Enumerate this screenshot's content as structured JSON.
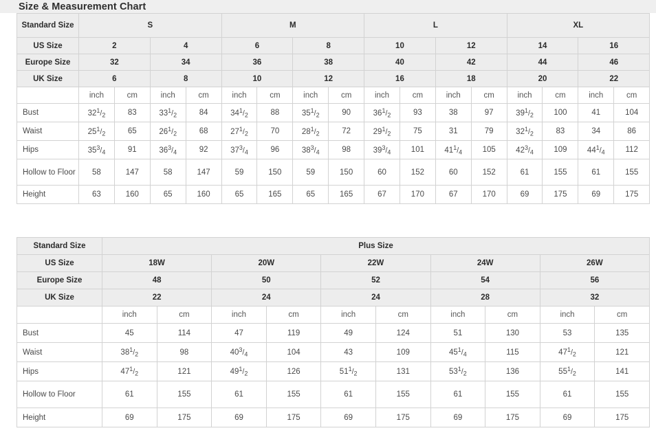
{
  "page": {
    "title": "Size & Measurement Chart",
    "accent_bg": "#efefef",
    "header_cell_bg": "#ededed",
    "border_color": "#d2d2d2"
  },
  "standard_chart": {
    "corner_label": "Standard Size",
    "groups": [
      {
        "label": "S",
        "span": 2
      },
      {
        "label": "M",
        "span": 2
      },
      {
        "label": "L",
        "span": 2
      },
      {
        "label": "XL",
        "span": 2
      }
    ],
    "size_rows": [
      {
        "label": "US Size",
        "values": [
          "2",
          "4",
          "6",
          "8",
          "10",
          "12",
          "14",
          "16"
        ]
      },
      {
        "label": "Europe Size",
        "values": [
          "32",
          "34",
          "36",
          "38",
          "40",
          "42",
          "44",
          "46"
        ]
      },
      {
        "label": "UK Size",
        "values": [
          "6",
          "8",
          "10",
          "12",
          "16",
          "18",
          "20",
          "22"
        ]
      }
    ],
    "unit_row": {
      "label": "",
      "units": [
        "inch",
        "cm",
        "inch",
        "cm",
        "inch",
        "cm",
        "inch",
        "cm",
        "inch",
        "cm",
        "inch",
        "cm",
        "inch",
        "cm",
        "inch",
        "cm"
      ]
    },
    "measurements": [
      {
        "label": "Bust",
        "cells": [
          {
            "whole": "32",
            "num": "1",
            "den": "2"
          },
          {
            "whole": "83"
          },
          {
            "whole": "33",
            "num": "1",
            "den": "2"
          },
          {
            "whole": "84"
          },
          {
            "whole": "34",
            "num": "1",
            "den": "2"
          },
          {
            "whole": "88"
          },
          {
            "whole": "35",
            "num": "1",
            "den": "2"
          },
          {
            "whole": "90"
          },
          {
            "whole": "36",
            "num": "1",
            "den": "2"
          },
          {
            "whole": "93"
          },
          {
            "whole": "38"
          },
          {
            "whole": "97"
          },
          {
            "whole": "39",
            "num": "1",
            "den": "2"
          },
          {
            "whole": "100"
          },
          {
            "whole": "41"
          },
          {
            "whole": "104"
          }
        ]
      },
      {
        "label": "Waist",
        "cells": [
          {
            "whole": "25",
            "num": "1",
            "den": "2"
          },
          {
            "whole": "65"
          },
          {
            "whole": "26",
            "num": "1",
            "den": "2"
          },
          {
            "whole": "68"
          },
          {
            "whole": "27",
            "num": "1",
            "den": "2"
          },
          {
            "whole": "70"
          },
          {
            "whole": "28",
            "num": "1",
            "den": "2"
          },
          {
            "whole": "72"
          },
          {
            "whole": "29",
            "num": "1",
            "den": "2"
          },
          {
            "whole": "75"
          },
          {
            "whole": "31"
          },
          {
            "whole": "79"
          },
          {
            "whole": "32",
            "num": "1",
            "den": "2"
          },
          {
            "whole": "83"
          },
          {
            "whole": "34"
          },
          {
            "whole": "86"
          }
        ]
      },
      {
        "label": "Hips",
        "cells": [
          {
            "whole": "35",
            "num": "3",
            "den": "4"
          },
          {
            "whole": "91"
          },
          {
            "whole": "36",
            "num": "3",
            "den": "4"
          },
          {
            "whole": "92"
          },
          {
            "whole": "37",
            "num": "3",
            "den": "4"
          },
          {
            "whole": "96"
          },
          {
            "whole": "38",
            "num": "3",
            "den": "4"
          },
          {
            "whole": "98"
          },
          {
            "whole": "39",
            "num": "3",
            "den": "4"
          },
          {
            "whole": "101"
          },
          {
            "whole": "41",
            "num": "1",
            "den": "4"
          },
          {
            "whole": "105"
          },
          {
            "whole": "42",
            "num": "3",
            "den": "4"
          },
          {
            "whole": "109"
          },
          {
            "whole": "44",
            "num": "1",
            "den": "4"
          },
          {
            "whole": "112"
          }
        ]
      },
      {
        "label": "Hollow to Floor",
        "tall": true,
        "cells": [
          {
            "whole": "58"
          },
          {
            "whole": "147"
          },
          {
            "whole": "58"
          },
          {
            "whole": "147"
          },
          {
            "whole": "59"
          },
          {
            "whole": "150"
          },
          {
            "whole": "59"
          },
          {
            "whole": "150"
          },
          {
            "whole": "60"
          },
          {
            "whole": "152"
          },
          {
            "whole": "60"
          },
          {
            "whole": "152"
          },
          {
            "whole": "61"
          },
          {
            "whole": "155"
          },
          {
            "whole": "61"
          },
          {
            "whole": "155"
          }
        ]
      },
      {
        "label": "Height",
        "cells": [
          {
            "whole": "63"
          },
          {
            "whole": "160"
          },
          {
            "whole": "65"
          },
          {
            "whole": "160"
          },
          {
            "whole": "65"
          },
          {
            "whole": "165"
          },
          {
            "whole": "65"
          },
          {
            "whole": "165"
          },
          {
            "whole": "67"
          },
          {
            "whole": "170"
          },
          {
            "whole": "67"
          },
          {
            "whole": "170"
          },
          {
            "whole": "69"
          },
          {
            "whole": "175"
          },
          {
            "whole": "69"
          },
          {
            "whole": "175"
          }
        ]
      }
    ]
  },
  "plus_chart": {
    "corner_label": "Standard Size",
    "group_label": "Plus Size",
    "size_rows": [
      {
        "label": "US Size",
        "values": [
          "18W",
          "20W",
          "22W",
          "24W",
          "26W"
        ]
      },
      {
        "label": "Europe Size",
        "values": [
          "48",
          "50",
          "52",
          "54",
          "56"
        ]
      },
      {
        "label": "UK Size",
        "values": [
          "22",
          "24",
          "24",
          "28",
          "32"
        ]
      }
    ],
    "unit_row": {
      "label": "",
      "units": [
        "inch",
        "cm",
        "inch",
        "cm",
        "inch",
        "cm",
        "inch",
        "cm",
        "inch",
        "cm"
      ]
    },
    "measurements": [
      {
        "label": "Bust",
        "cells": [
          {
            "whole": "45"
          },
          {
            "whole": "114"
          },
          {
            "whole": "47"
          },
          {
            "whole": "119"
          },
          {
            "whole": "49"
          },
          {
            "whole": "124"
          },
          {
            "whole": "51"
          },
          {
            "whole": "130"
          },
          {
            "whole": "53"
          },
          {
            "whole": "135"
          }
        ]
      },
      {
        "label": "Waist",
        "cells": [
          {
            "whole": "38",
            "num": "1",
            "den": "2"
          },
          {
            "whole": "98"
          },
          {
            "whole": "40",
            "num": "3",
            "den": "4"
          },
          {
            "whole": "104"
          },
          {
            "whole": "43"
          },
          {
            "whole": "109"
          },
          {
            "whole": "45",
            "num": "1",
            "den": "4"
          },
          {
            "whole": "115"
          },
          {
            "whole": "47",
            "num": "1",
            "den": "2"
          },
          {
            "whole": "121"
          }
        ]
      },
      {
        "label": "Hips",
        "cells": [
          {
            "whole": "47",
            "num": "1",
            "den": "2"
          },
          {
            "whole": "121"
          },
          {
            "whole": "49",
            "num": "1",
            "den": "2"
          },
          {
            "whole": "126"
          },
          {
            "whole": "51",
            "num": "1",
            "den": "2"
          },
          {
            "whole": "131"
          },
          {
            "whole": "53",
            "num": "1",
            "den": "2"
          },
          {
            "whole": "136"
          },
          {
            "whole": "55",
            "num": "1",
            "den": "2"
          },
          {
            "whole": "141"
          }
        ]
      },
      {
        "label": "Hollow to Floor",
        "tall": true,
        "cells": [
          {
            "whole": "61"
          },
          {
            "whole": "155"
          },
          {
            "whole": "61"
          },
          {
            "whole": "155"
          },
          {
            "whole": "61"
          },
          {
            "whole": "155"
          },
          {
            "whole": "61"
          },
          {
            "whole": "155"
          },
          {
            "whole": "61"
          },
          {
            "whole": "155"
          }
        ]
      },
      {
        "label": "Height",
        "cells": [
          {
            "whole": "69"
          },
          {
            "whole": "175"
          },
          {
            "whole": "69"
          },
          {
            "whole": "175"
          },
          {
            "whole": "69"
          },
          {
            "whole": "175"
          },
          {
            "whole": "69"
          },
          {
            "whole": "175"
          },
          {
            "whole": "69"
          },
          {
            "whole": "175"
          }
        ]
      }
    ]
  }
}
